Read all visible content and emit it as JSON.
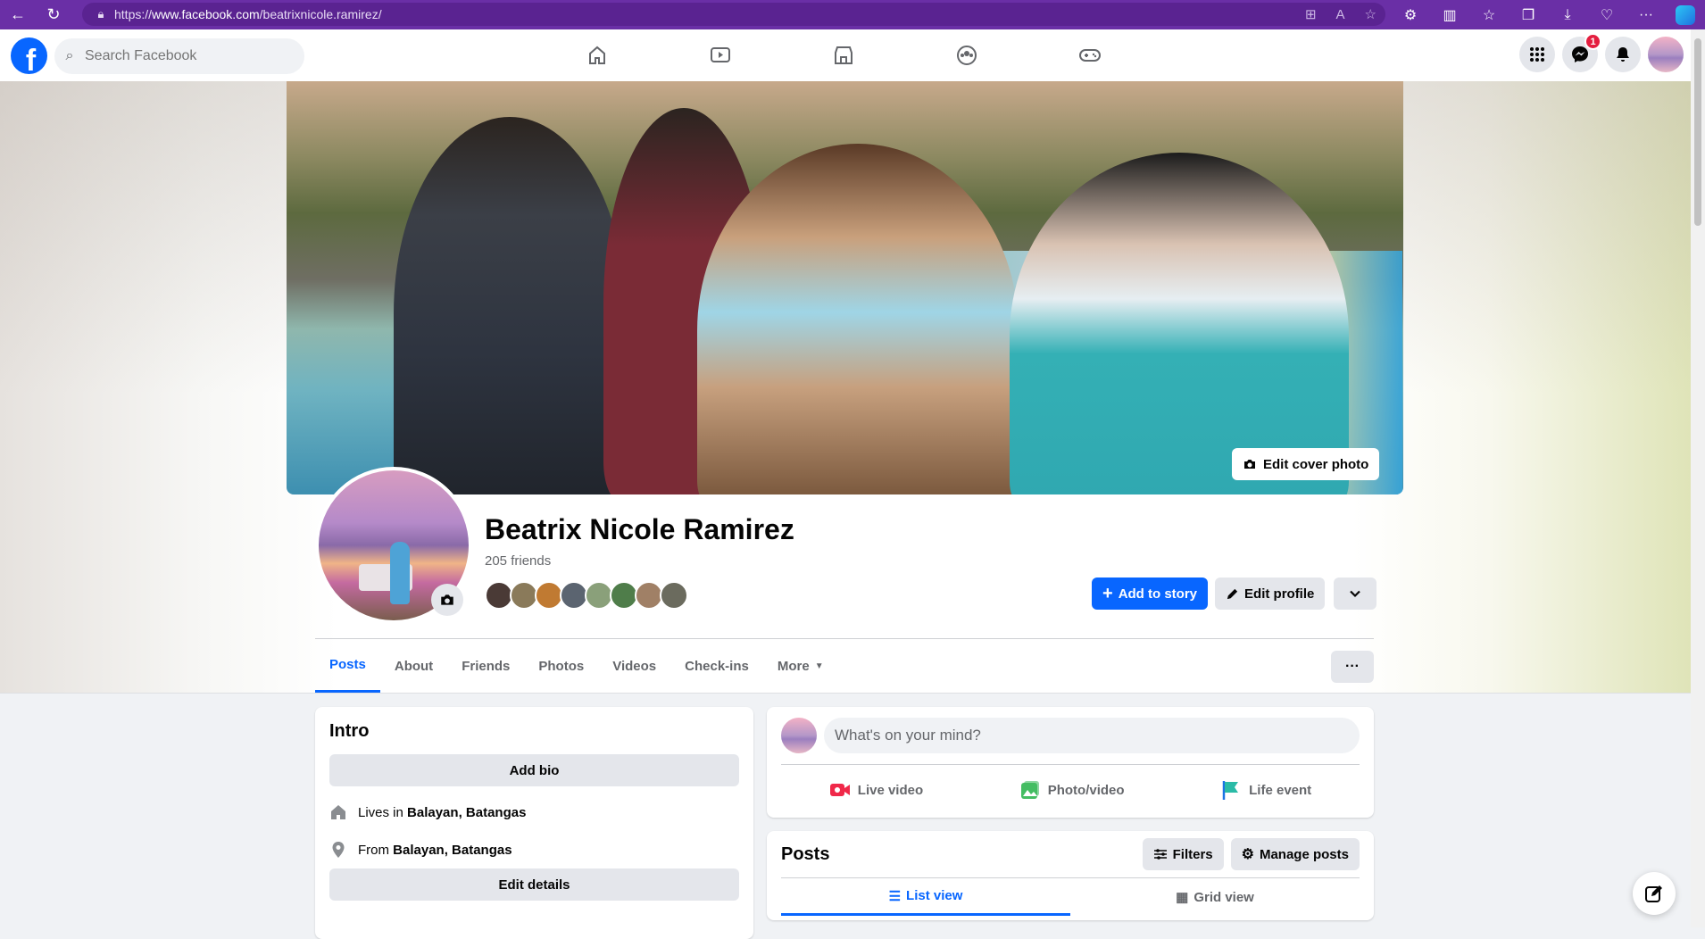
{
  "browser": {
    "url_prefix": "https://",
    "url_domain": "www.facebook.com",
    "url_path": "/beatrixnicole.ramirez/"
  },
  "nav": {
    "search_placeholder": "Search Facebook",
    "messenger_badge": "1"
  },
  "cover": {
    "edit_label": "Edit cover photo"
  },
  "profile": {
    "name": "Beatrix Nicole Ramirez",
    "friends": "205 friends",
    "add_story": "Add to story",
    "edit_profile": "Edit profile"
  },
  "tabs": {
    "posts": "Posts",
    "about": "About",
    "friends": "Friends",
    "photos": "Photos",
    "videos": "Videos",
    "checkins": "Check-ins",
    "more": "More"
  },
  "intro": {
    "title": "Intro",
    "add_bio": "Add bio",
    "lives_prefix": "Lives in ",
    "lives_place": "Balayan, Batangas",
    "from_prefix": "From ",
    "from_place": "Balayan, Batangas",
    "edit_details": "Edit details"
  },
  "composer": {
    "placeholder": "What's on your mind?",
    "live_video": "Live video",
    "photo_video": "Photo/video",
    "life_event": "Life event"
  },
  "posts": {
    "title": "Posts",
    "filters": "Filters",
    "manage": "Manage posts",
    "list_view": "List view",
    "grid_view": "Grid view"
  },
  "colors": {
    "accent": "#0866ff",
    "browser": "#6a2fa6"
  }
}
